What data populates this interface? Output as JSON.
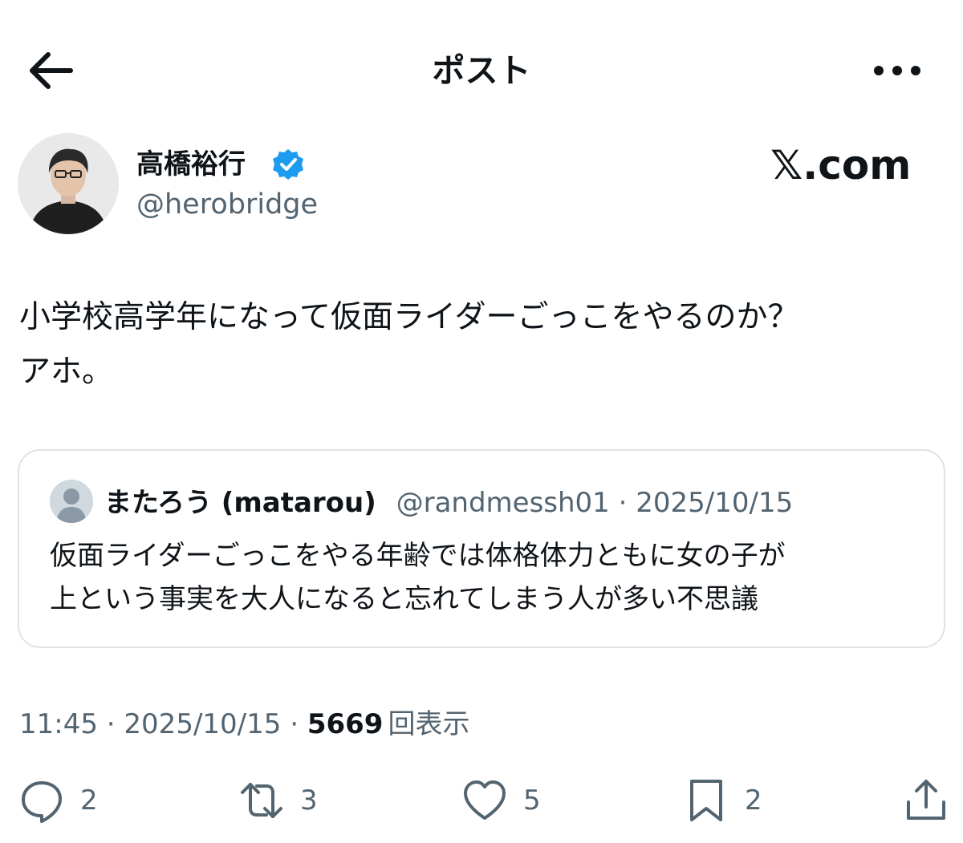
{
  "header": {
    "title": "ポスト",
    "back_icon": "arrow-left-icon",
    "more_icon": "more-horizontal-icon"
  },
  "author": {
    "name": "高橋裕行",
    "handle": "@herobridge",
    "verified": true,
    "verified_color": "#1d9bf0"
  },
  "watermark": "𝕏.com",
  "post": {
    "text": "小学校高学年になって仮面ライダーごっこをやるのか？\nアホ。"
  },
  "quote": {
    "name": "またろう (matarou)",
    "handle": "@randmessh01",
    "separator": " · ",
    "date": "2025/10/15",
    "text": "仮面ライダーごっこをやる年齢では体格体力ともに女の子が\n上という事実を大人になると忘れてしまう人が多い不思議"
  },
  "meta": {
    "time": "11:45",
    "date": "2025/10/15",
    "separator": " · ",
    "views": "5669",
    "views_label": "回表示"
  },
  "actions": {
    "reply": {
      "icon": "reply-icon",
      "count": "2"
    },
    "repost": {
      "icon": "repost-icon",
      "count": "3"
    },
    "like": {
      "icon": "heart-icon",
      "count": "5"
    },
    "bookmark": {
      "icon": "bookmark-icon",
      "count": "2"
    },
    "share": {
      "icon": "share-icon"
    }
  },
  "colors": {
    "text": "#0f1419",
    "secondary": "#536471",
    "border": "#dfe3e6",
    "accent": "#1d9bf0"
  }
}
